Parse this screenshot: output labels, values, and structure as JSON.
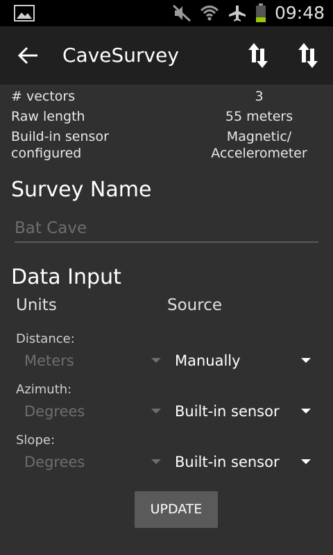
{
  "status_bar": {
    "time": "09:48",
    "icons": [
      "gallery-icon",
      "mute-icon",
      "wifi-icon",
      "airplane-mode-icon",
      "battery-icon"
    ],
    "battery_color": "#99cc00"
  },
  "app_bar": {
    "title": "CaveSurvey",
    "icons": [
      "back-arrow-icon",
      "sort-icon",
      "sort-icon"
    ]
  },
  "info": {
    "vectors_label": "# vectors",
    "vectors_value": "3",
    "raw_length_label": "Raw length",
    "raw_length_value": "55 meters",
    "sensor_label_line1": "Build-in sensor",
    "sensor_label_line2": "configured",
    "sensor_value_line1": "Magnetic/",
    "sensor_value_line2": "Accelerometer"
  },
  "survey_name": {
    "heading": "Survey Name",
    "placeholder": "Bat Cave",
    "value": ""
  },
  "data_input": {
    "heading": "Data Input",
    "units_header": "Units",
    "source_header": "Source",
    "distance": {
      "label": "Distance:",
      "unit": "Meters",
      "source": "Manually"
    },
    "azimuth": {
      "label": "Azimuth:",
      "unit": "Degrees",
      "source": "Built-in sensor"
    },
    "slope": {
      "label": "Slope:",
      "unit": "Degrees",
      "source": "Built-in sensor"
    }
  },
  "update_button": "UPDATE",
  "colors": {
    "background": "#303030",
    "app_bar": "#202020",
    "status_bar": "#000000",
    "disabled_text": "#6e6e6e",
    "button": "#5a5a5a"
  }
}
